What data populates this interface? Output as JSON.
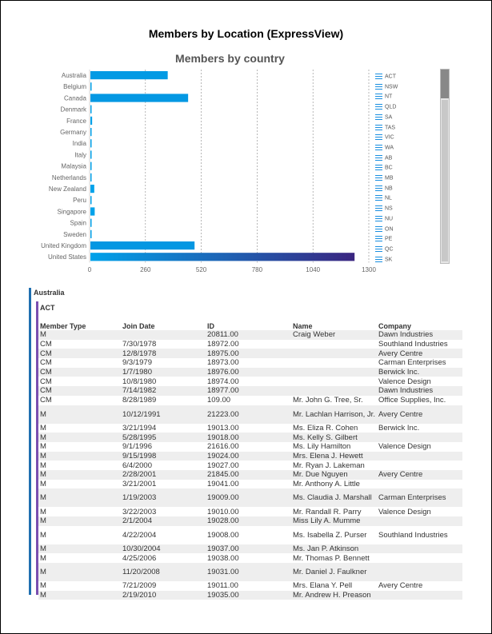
{
  "report_title": "Members by Location (ExpressView)",
  "chart_data": {
    "type": "bar",
    "title": "Members by country",
    "categories": [
      "Australia",
      "Belgium",
      "Canada",
      "Denmark",
      "France",
      "Germany",
      "India",
      "Italy",
      "Malaysia",
      "Netherlands",
      "New Zealand",
      "Peru",
      "Singapore",
      "Spain",
      "Sweden",
      "United Kingdom",
      "United States"
    ],
    "values": [
      360,
      5,
      455,
      3,
      8,
      3,
      5,
      4,
      4,
      3,
      18,
      3,
      20,
      3,
      3,
      485,
      1230
    ],
    "xticks": [
      "0",
      "260",
      "520",
      "780",
      "1040",
      "1300"
    ],
    "xlim": [
      0,
      1300
    ],
    "grid": true,
    "colors": {
      "low": "#00a2ea",
      "high": "#3a2580"
    }
  },
  "legend": [
    "ACT",
    "NSW",
    "NT",
    "QLD",
    "SA",
    "TAS",
    "VIC",
    "WA",
    "AB",
    "BC",
    "MB",
    "NB",
    "NL",
    "NS",
    "NU",
    "ON",
    "PE",
    "QC",
    "SK"
  ],
  "group_country": "Australia",
  "group_state": "ACT",
  "table": {
    "headers": [
      "Member Type",
      "Join Date",
      "ID",
      "Name",
      "Company"
    ],
    "rows": [
      [
        "M",
        "",
        "20811.00",
        "Craig Weber",
        "Dawn Industries"
      ],
      [
        "CM",
        "7/30/1978",
        "18972.00",
        "",
        "Southland Industries"
      ],
      [
        "CM",
        "12/8/1978",
        "18975.00",
        "",
        "Avery Centre"
      ],
      [
        "CM",
        "9/3/1979",
        "18973.00",
        "",
        "Carman Enterprises"
      ],
      [
        "CM",
        "1/7/1980",
        "18976.00",
        "",
        "Berwick Inc."
      ],
      [
        "CM",
        "10/8/1980",
        "18974.00",
        "",
        "Valence Design"
      ],
      [
        "CM",
        "7/14/1982",
        "18977.00",
        "",
        "Dawn Industries"
      ],
      [
        "CM",
        "8/28/1989",
        "109.00",
        "Mr. John G. Tree, Sr.",
        "Office Supplies, Inc."
      ],
      [
        "M",
        "10/12/1991",
        "21223.00",
        "Mr. Lachlan Harrison, Jr.",
        "Avery Centre"
      ],
      [
        "M",
        "3/21/1994",
        "19013.00",
        "Ms. Eliza R. Cohen",
        "Berwick Inc."
      ],
      [
        "M",
        "5/28/1995",
        "19018.00",
        "Ms. Kelly S. Gilbert",
        ""
      ],
      [
        "M",
        "9/1/1996",
        "21616.00",
        "Ms. Lily Hamilton",
        "Valence Design"
      ],
      [
        "M",
        "9/15/1998",
        "19024.00",
        "Mrs. Elena J. Hewett",
        ""
      ],
      [
        "M",
        "6/4/2000",
        "19027.00",
        "Mr. Ryan J. Lakeman",
        ""
      ],
      [
        "M",
        "2/28/2001",
        "21845.00",
        "Mr. Due Nguyen",
        "Avery Centre"
      ],
      [
        "M",
        "3/21/2001",
        "19041.00",
        "Mr. Anthony A. Little",
        ""
      ],
      [
        "M",
        "1/19/2003",
        "19009.00",
        "Ms. Claudia J. Marshall",
        "Carman Enterprises"
      ],
      [
        "M",
        "3/22/2003",
        "19010.00",
        "Mr. Randall R. Parry",
        "Valence Design"
      ],
      [
        "M",
        "2/1/2004",
        "19028.00",
        "Miss Lily A. Mumme",
        ""
      ],
      [
        "M",
        "4/22/2004",
        "19008.00",
        "Ms. Isabella Z. Purser",
        "Southland Industries"
      ],
      [
        "M",
        "10/30/2004",
        "19037.00",
        "Ms. Jan P. Atkinson",
        ""
      ],
      [
        "M",
        "4/25/2006",
        "19038.00",
        "Mr. Thomas P. Bennett",
        ""
      ],
      [
        "M",
        "11/20/2008",
        "19031.00",
        "Mr. Daniel J. Faulkner",
        ""
      ],
      [
        "M",
        "7/21/2009",
        "19011.00",
        "Mrs. Elana Y. Pell",
        "Avery Centre"
      ],
      [
        "M",
        "2/19/2010",
        "19035.00",
        "Mr. Andrew H. Preason",
        ""
      ]
    ]
  }
}
